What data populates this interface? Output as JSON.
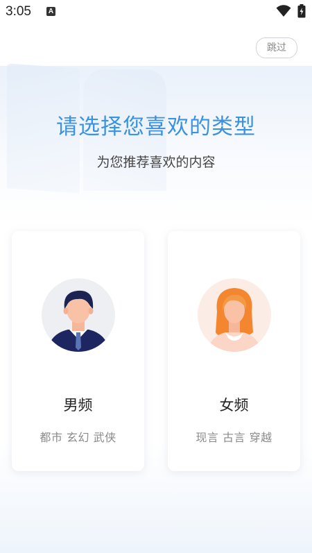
{
  "status_bar": {
    "time": "3:05",
    "notification_icon": "a-icon",
    "wifi_icon": "wifi-icon",
    "battery_icon": "battery-charging-icon"
  },
  "skip_label": "跳过",
  "title": "请选择您喜欢的类型",
  "subtitle": "为您推荐喜欢的内容",
  "cards": [
    {
      "label": "男频",
      "tags": "都市 玄幻 武侠",
      "icon": "male-avatar-icon"
    },
    {
      "label": "女频",
      "tags": "现言 古言 穿越",
      "icon": "female-avatar-icon"
    }
  ],
  "colors": {
    "accent": "#3a92e0",
    "text": "#222222",
    "muted": "#8a8a8a"
  }
}
